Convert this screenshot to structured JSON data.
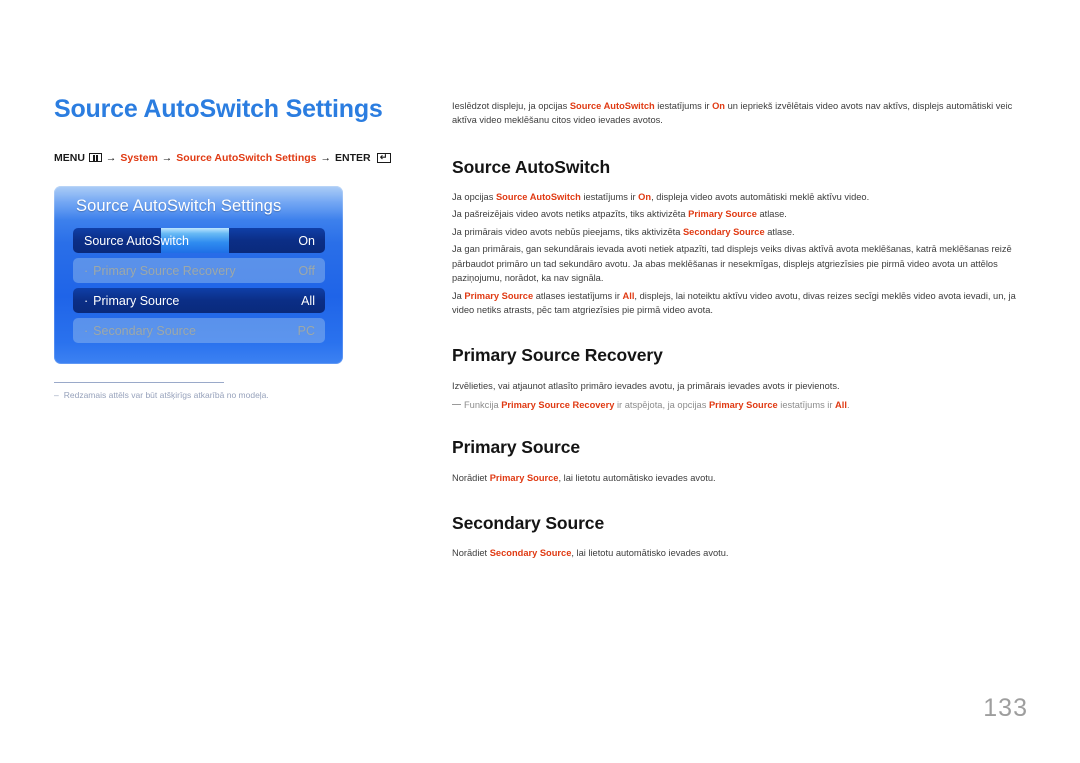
{
  "page": {
    "number": "133",
    "title": "Source AutoSwitch Settings"
  },
  "breadcrumb": {
    "menu_label": "MENU",
    "menu_icon": "menu-grid-icon",
    "arrow": "→",
    "item1": "System",
    "item2": "Source AutoSwitch Settings",
    "enter_label": "ENTER",
    "enter_icon": "enter-return-icon",
    "accent_color": "#e03a13"
  },
  "osd": {
    "title": "Source AutoSwitch Settings",
    "rows": [
      {
        "bullet": "",
        "label": "Source AutoSwitch",
        "value": "On",
        "state": "enabled",
        "focused": true
      },
      {
        "bullet": "·",
        "label": "Primary Source Recovery",
        "value": "Off",
        "state": "disabled",
        "focused": false
      },
      {
        "bullet": "·",
        "label": "Primary Source",
        "value": "All",
        "state": "enabled",
        "focused": false
      },
      {
        "bullet": "·",
        "label": "Secondary Source",
        "value": "PC",
        "state": "disabled",
        "focused": false
      }
    ],
    "panel_color": "#2a6fe8",
    "row_enabled_color": "#0b2e86"
  },
  "image_note": {
    "dash": "–",
    "text": "Redzamais attēls var būt atšķirīgs atkarībā no modeļa."
  },
  "content": {
    "intro": {
      "pre": "Ieslēdzot displeju, ja opcijas ",
      "hl1": "Source AutoSwitch",
      "mid1": " iestatījums ir ",
      "hl2": "On",
      "post": " un iepriekš izvēlētais video avots nav aktīvs, displejs automātiski veic aktīva video meklēšanu citos video ievades avotos."
    },
    "sections": [
      {
        "heading": "Source AutoSwitch",
        "paragraphs": [
          {
            "pre": "Ja opcijas ",
            "hl1": "Source AutoSwitch",
            "mid1": " iestatījums ir ",
            "hl2": "On",
            "post": ", displeja video avots automātiski meklē aktīvu video."
          },
          {
            "pre": "Ja pašreizējais video avots netiks atpazīts, tiks aktivizēta ",
            "hl1": "Primary Source",
            "post": " atlase."
          },
          {
            "pre": "Ja primārais video avots nebūs pieejams, tiks aktivizēta ",
            "hl1": "Secondary Source",
            "post": " atlase."
          },
          {
            "pre": "Ja gan primārais, gan sekundārais ievada avoti netiek atpazīti, tad displejs veiks divas aktīvā avota meklēšanas, katrā meklēšanas reizē pārbaudot primāro un tad sekundāro avotu. Ja abas meklēšanas ir nesekmīgas, displejs atgriezīsies pie pirmā video avota un attēlos paziņojumu, norādot, ka nav signāla."
          },
          {
            "pre": "Ja ",
            "hl1": "Primary Source",
            "mid1": " atlases iestatījums ir ",
            "hl2": "All",
            "post": ", displejs, lai noteiktu aktīvu video avotu, divas reizes secīgi meklēs video avota ievadi, un, ja video netiks atrasts, pēc tam atgriezīsies pie pirmā video avota."
          }
        ]
      },
      {
        "heading": "Primary Source Recovery",
        "paragraphs": [
          {
            "pre": "Izvēlieties, vai atjaunot atlasīto primāro ievades avotu, ja primārais ievades avots ir pievienots.",
            "post": ""
          }
        ],
        "note": {
          "pre": "Funkcija ",
          "hl1": "Primary Source Recovery",
          "mid1": " ir atspējota, ja opcijas ",
          "hl2": "Primary Source",
          "mid2": " iestatījums ir ",
          "hl3": "All",
          "post": "."
        }
      },
      {
        "heading": "Primary Source",
        "paragraphs": [
          {
            "pre": "Norādiet ",
            "hl1": "Primary Source",
            "post": ", lai lietotu automātisko ievades avotu."
          }
        ]
      },
      {
        "heading": "Secondary Source",
        "paragraphs": [
          {
            "pre": "Norādiet ",
            "hl1": "Secondary Source",
            "post": ", lai lietotu automātisko ievades avotu."
          }
        ]
      }
    ]
  }
}
